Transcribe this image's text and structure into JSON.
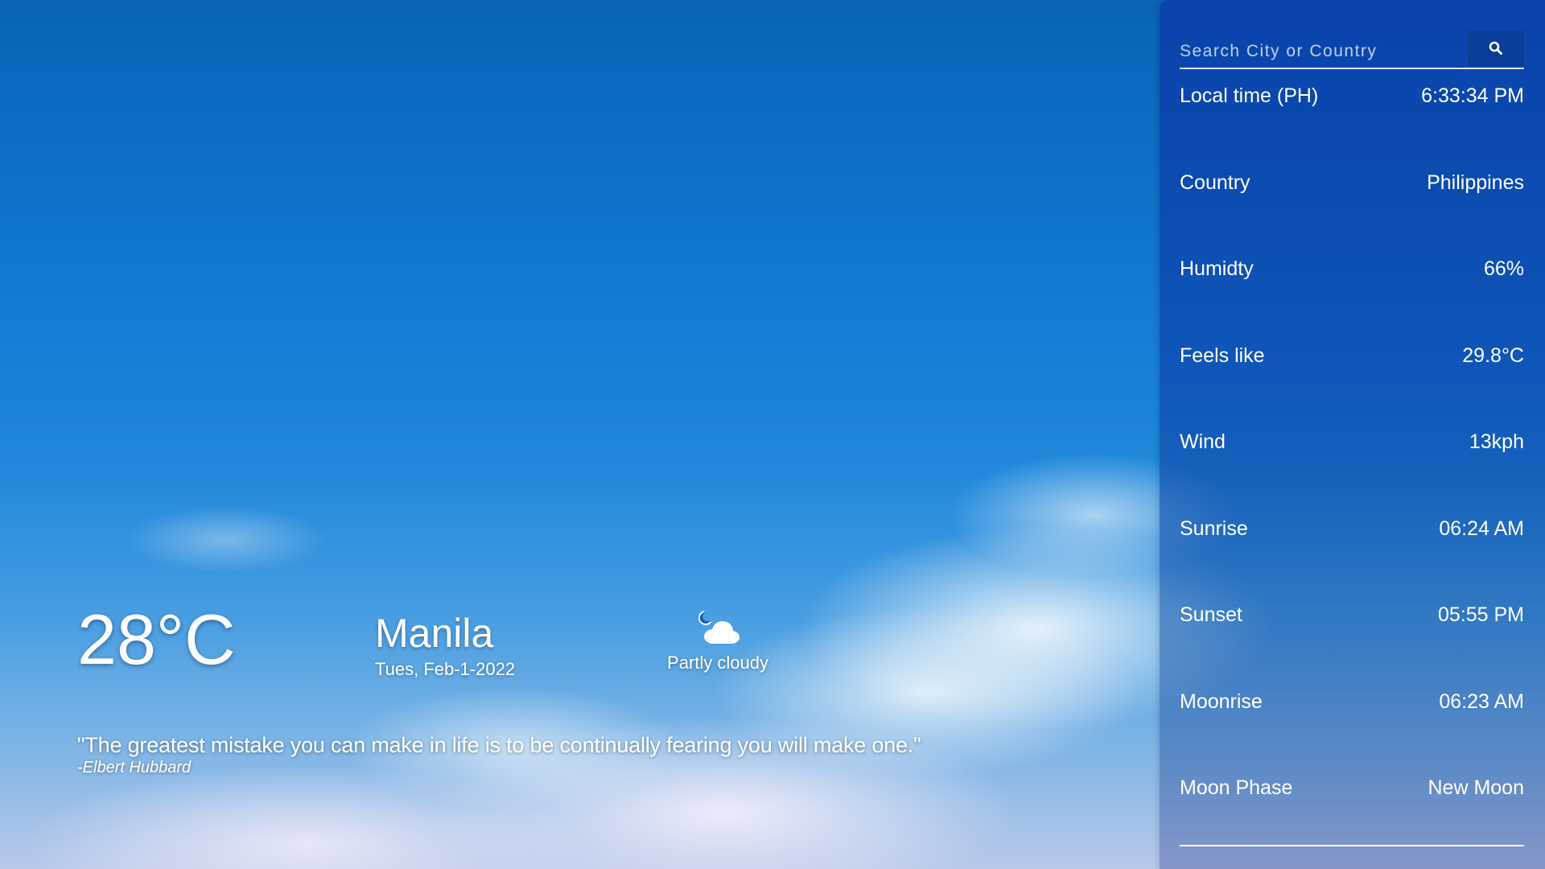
{
  "colors": {
    "sky_top": "#0a63b8",
    "sidebar": "#0a40aa",
    "search_button": "#0a3c9a",
    "text": "#ffffff"
  },
  "current": {
    "temperature": "28°C",
    "city": "Manila",
    "date": "Tues, Feb-1-2022",
    "condition": "Partly cloudy",
    "condition_icon": "partly-cloudy-night-icon"
  },
  "quote": {
    "text": "\"The greatest mistake you can make in life is to be continually fearing you will make one.\"",
    "author": "-Elbert Hubbard"
  },
  "search": {
    "placeholder": "Search City or Country",
    "button_icon": "search-icon"
  },
  "details": [
    {
      "label": "Local time (PH)",
      "value": "6:33:34 PM"
    },
    {
      "label": "Country",
      "value": "Philippines"
    },
    {
      "label": "Humidty",
      "value": "66%"
    },
    {
      "label": "Feels like",
      "value": "29.8°C"
    },
    {
      "label": "Wind",
      "value": "13kph"
    },
    {
      "label": "Sunrise",
      "value": "06:24 AM"
    },
    {
      "label": "Sunset",
      "value": "05:55 PM"
    },
    {
      "label": "Moonrise",
      "value": "06:23 AM"
    },
    {
      "label": "Moon Phase",
      "value": "New Moon"
    }
  ]
}
